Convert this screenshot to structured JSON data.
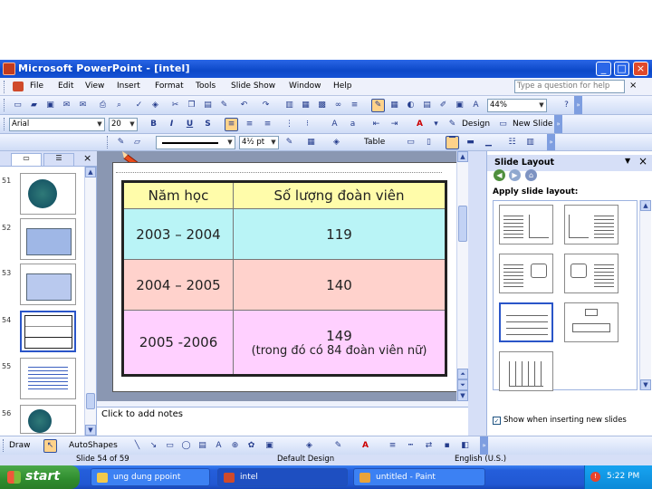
{
  "window": {
    "title": "Microsoft PowerPoint - [intel]",
    "controls": [
      "_",
      "□",
      "×"
    ]
  },
  "menu": {
    "items": [
      "File",
      "Edit",
      "View",
      "Insert",
      "Format",
      "Tools",
      "Slide Show",
      "Window",
      "Help"
    ],
    "ask_placeholder": "Type a question for help"
  },
  "standard_toolbar": {
    "zoom": "44%",
    "design_label": "Design",
    "new_slide_label": "New Slide"
  },
  "format_toolbar": {
    "font": "Arial",
    "size": "20",
    "bold": "B",
    "italic": "I",
    "underline": "U",
    "shadow": "S"
  },
  "tables_toolbar": {
    "line_weight": "4½ pt",
    "table_label": "Table"
  },
  "left_pane": {
    "tab1": "▭",
    "tab2": "☰",
    "close": "×",
    "slides": [
      {
        "num": "51"
      },
      {
        "num": "52"
      },
      {
        "num": "53"
      },
      {
        "num": "54"
      },
      {
        "num": "55"
      },
      {
        "num": "56"
      }
    ]
  },
  "slide_table": {
    "headers": [
      "Năm học",
      "Số lượng đoàn viên"
    ],
    "rows": [
      {
        "year": "2003 – 2004",
        "count": "119",
        "note": ""
      },
      {
        "year": "2004 – 2005",
        "count": "140",
        "note": ""
      },
      {
        "year": "2005 -2006",
        "count": "149",
        "note": "(trong đó có 84 đoàn viên nữ)"
      }
    ],
    "colors": {
      "header": "#fffcaa",
      "row1": "#b9f4f6",
      "row2": "#ffd2cc",
      "row3": "#ffd0ff"
    }
  },
  "notes": {
    "placeholder": "Click to add notes"
  },
  "task_pane": {
    "title": "Slide Layout",
    "apply_label": "Apply slide layout:",
    "show_when_label": "Show when inserting new slides",
    "show_when_checked": true
  },
  "drawing_toolbar": {
    "draw_label": "Draw",
    "autoshapes_label": "AutoShapes"
  },
  "status_bar": {
    "slide_info": "Slide 54 of 59",
    "design": "Default Design",
    "language": "English (U.S.)"
  },
  "taskbar": {
    "start_label": "start",
    "tasks": [
      {
        "label": "ung dung ppoint",
        "icon": "folder-icon",
        "color": "#f2c94c"
      },
      {
        "label": "intel",
        "icon": "powerpoint-icon",
        "color": "#d04a2a"
      },
      {
        "label": "untitled - Paint",
        "icon": "paint-icon",
        "color": "#e8a33a"
      }
    ],
    "clock": "5:22 PM"
  },
  "theme": {
    "title_bar": "#0c48c8",
    "accent": "#2a55c8",
    "start_green": "#2f8c2e"
  }
}
